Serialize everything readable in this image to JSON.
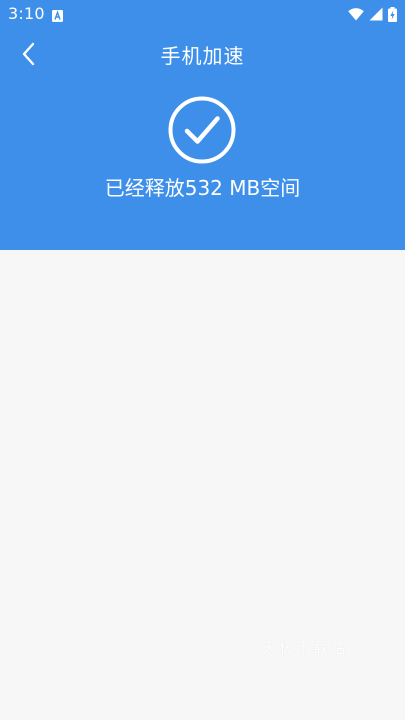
{
  "status_bar": {
    "time": "3:10",
    "notification_icon": "a-box-icon",
    "icons": [
      "wifi-icon",
      "signal-icon",
      "battery-icon"
    ]
  },
  "header": {
    "back_icon": "chevron-left-icon",
    "title": "手机加速",
    "check_icon": "check-circle-icon",
    "result_text": "已经释放532 MB空间"
  },
  "watermark": {
    "text": "天极下载站"
  },
  "colors": {
    "primary": "#3d8fea",
    "background": "#f7f7f7",
    "text_on_primary": "#ffffff"
  }
}
